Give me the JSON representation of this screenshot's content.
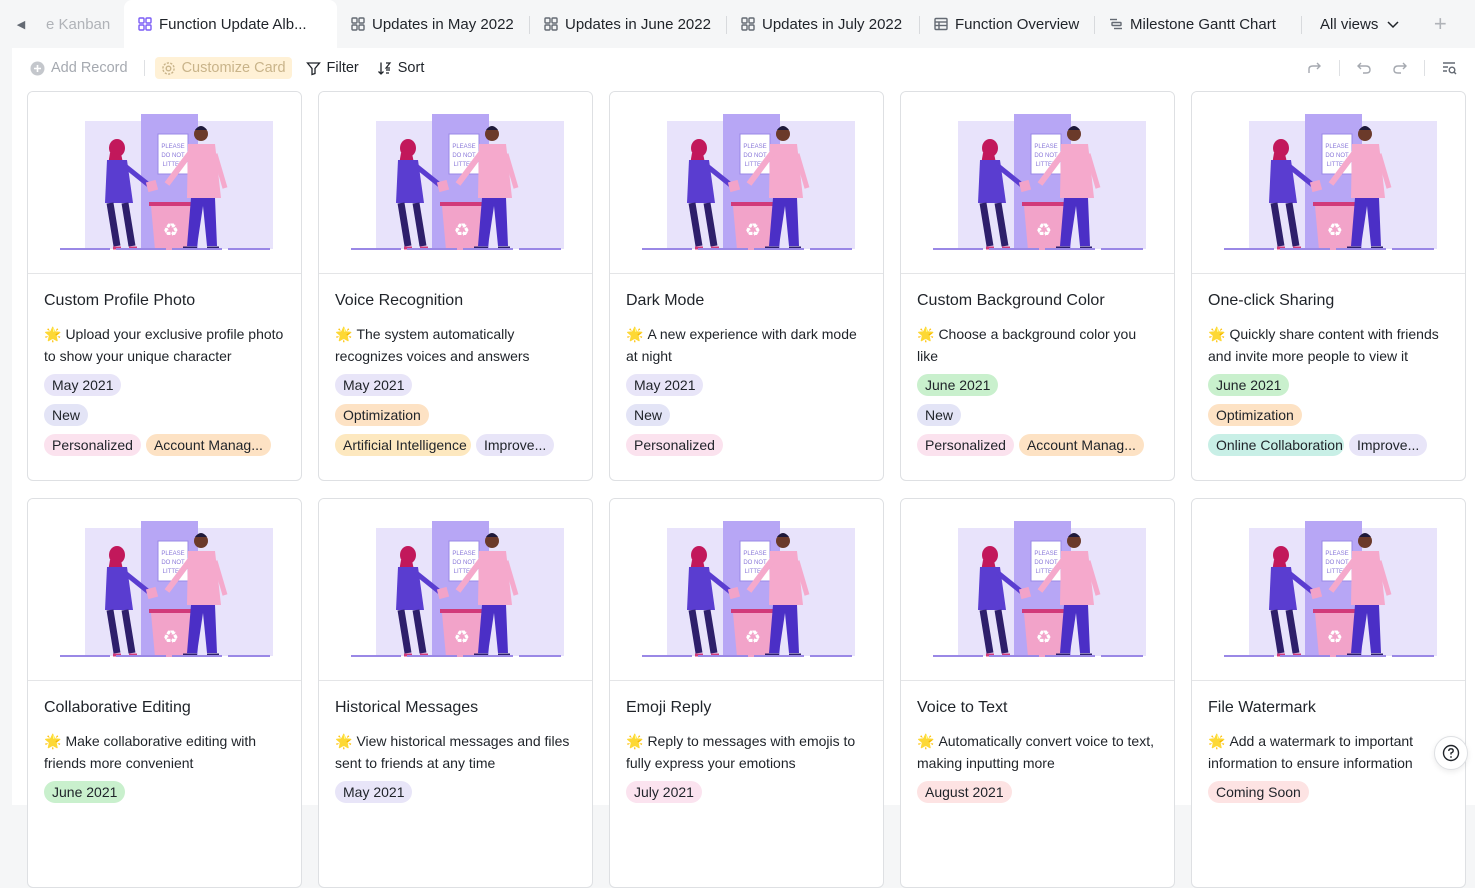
{
  "tabs": {
    "partial_label": "e Kanban",
    "items": [
      {
        "label": "Function Update Alb...",
        "icon": "grid-icon",
        "active": true
      },
      {
        "label": "Updates in May 2022",
        "icon": "grid-icon"
      },
      {
        "label": "Updates in June 2022",
        "icon": "grid-icon"
      },
      {
        "label": "Updates in July 2022",
        "icon": "grid-icon"
      },
      {
        "label": "Function Overview",
        "icon": "table-icon"
      },
      {
        "label": "Milestone Gantt Chart",
        "icon": "gantt-icon"
      }
    ],
    "all_views": "All views",
    "add": "+"
  },
  "toolbar": {
    "add_record": "Add Record",
    "customize_card": "Customize Card",
    "filter": "Filter",
    "sort": "Sort"
  },
  "colors": {
    "accent": "#7b5cf5",
    "month_purple": "#e8e5f8",
    "month_green": "#c9f0cd",
    "month_pink": "#fbe3ef",
    "new": "#e3e4f6",
    "optimization": "#fde2c4",
    "personalized": "#fbe2ee",
    "account": "#fde2c4",
    "ai": "#fde8bf",
    "improve": "#e8e5f8",
    "online": "#c8efe6",
    "coming": "#fde3e3"
  },
  "illustration_text": [
    "PLEASE",
    "DO NOT",
    "LITTER"
  ],
  "cards": [
    {
      "title": "Custom Profile Photo",
      "star": "🌟",
      "desc": "Upload your exclusive profile photo to show your unique character",
      "month": "May 2021",
      "month_color": "#e8e5f8",
      "type": "New",
      "type_color": "#e3e4f6",
      "tags": [
        {
          "label": "Personalized",
          "color": "#fbe2ee"
        },
        {
          "label": "Account Manag...",
          "color": "#fde2c4"
        }
      ]
    },
    {
      "title": "Voice Recognition",
      "star": "🌟",
      "desc": "The system automatically recognizes voices and answers",
      "month": "May 2021",
      "month_color": "#e8e5f8",
      "type": "Optimization",
      "type_color": "#fde2c4",
      "tags": [
        {
          "label": "Artificial Intelligence",
          "color": "#fde8bf"
        },
        {
          "label": "Improve...",
          "color": "#e8e5f8"
        }
      ]
    },
    {
      "title": "Dark Mode",
      "star": "🌟",
      "desc": "A new experience with dark mode at night",
      "month": "May 2021",
      "month_color": "#e8e5f8",
      "type": "New",
      "type_color": "#e3e4f6",
      "tags": [
        {
          "label": "Personalized",
          "color": "#fbe2ee"
        }
      ]
    },
    {
      "title": "Custom Background Color",
      "star": "🌟",
      "desc": "Choose a background color you like",
      "month": "June 2021",
      "month_color": "#c9f0cd",
      "type": "New",
      "type_color": "#e3e4f6",
      "tags": [
        {
          "label": "Personalized",
          "color": "#fbe2ee"
        },
        {
          "label": "Account Manag...",
          "color": "#fde2c4"
        }
      ]
    },
    {
      "title": "One-click Sharing",
      "star": "🌟",
      "desc": "Quickly share content with friends and invite more people to view it",
      "month": "June 2021",
      "month_color": "#c9f0cd",
      "type": "Optimization",
      "type_color": "#fde2c4",
      "tags": [
        {
          "label": "Online Collaboration",
          "color": "#c8efe6"
        },
        {
          "label": "Improve...",
          "color": "#e8e5f8"
        }
      ]
    },
    {
      "title": "Collaborative Editing",
      "star": "🌟",
      "desc": "Make collaborative editing with friends more convenient",
      "month": "June 2021",
      "month_color": "#c9f0cd"
    },
    {
      "title": "Historical Messages",
      "star": "🌟",
      "desc": "View historical messages and files sent to friends at any time",
      "month": "May 2021",
      "month_color": "#e8e5f8"
    },
    {
      "title": "Emoji Reply",
      "star": "🌟",
      "desc": "Reply to messages with emojis to fully express your emotions",
      "month": "July 2021",
      "month_color": "#fbe3ef"
    },
    {
      "title": "Voice to Text",
      "star": "🌟",
      "desc": "Automatically convert voice to text, making inputting more",
      "month": "August 2021",
      "month_color": "#fde3e3"
    },
    {
      "title": "File Watermark",
      "star": "🌟",
      "desc": "Add a watermark to important information to ensure information",
      "month": "Coming Soon",
      "month_color": "#fde3e3"
    }
  ]
}
